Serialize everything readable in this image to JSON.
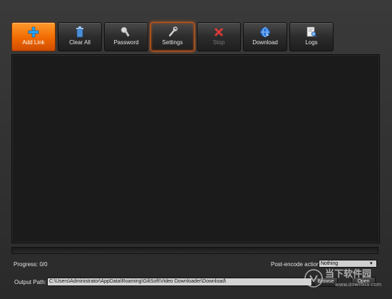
{
  "toolbar": {
    "add_link": "Add Link",
    "clear_all": "Clear All",
    "password": "Password",
    "settings": "Settings",
    "stop": "Stop",
    "download": "Download",
    "logs": "Logs"
  },
  "status": {
    "progress_label": "Progress: 0/0",
    "progress_fraction": 0,
    "post_encode_label": "Post-encode action:",
    "post_encode_value": "Nothing"
  },
  "output": {
    "label": "Output Path:",
    "path": "C:\\Users\\Administrator\\AppData\\Roaming\\GiliSoft\\Video Downloader\\Download\\",
    "browse": "Browse",
    "open": "Open"
  },
  "watermark": {
    "text": "当下软件园",
    "domain": "www.downxia.com"
  },
  "colors": {
    "accent": "#f07000",
    "panel": "#1b1b1b",
    "background": "#303030"
  }
}
